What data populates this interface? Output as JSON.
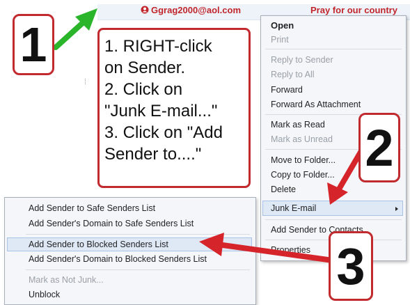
{
  "message": {
    "sender": "Ggrag2000@aol.com",
    "subject": "Pray for our country"
  },
  "instructions": {
    "lines": [
      "1. RIGHT-click",
      "on Sender.",
      "2. Click on",
      "\"Junk E-mail...\"",
      "3. Click on \"Add",
      "Sender to....\""
    ]
  },
  "context_menu": {
    "open": "Open",
    "print": "Print",
    "reply_to_sender": "Reply to Sender",
    "reply_to_all": "Reply to All",
    "forward": "Forward",
    "forward_as_attachment": "Forward As Attachment",
    "mark_as_read": "Mark as Read",
    "mark_as_unread": "Mark as Unread",
    "move_to_folder": "Move to Folder...",
    "copy_to_folder": "Copy to Folder...",
    "delete": "Delete",
    "junk_email": "Junk E-mail",
    "add_sender_to_contacts": "Add Sender to Contacts",
    "properties": "Properties"
  },
  "junk_submenu": {
    "safe_senders": "Add Sender to Safe Senders List",
    "safe_domain": "Add Sender's Domain to Safe Senders List",
    "blocked_senders": "Add Sender to Blocked Senders List",
    "blocked_domain": "Add Sender's Domain to Blocked Senders List",
    "mark_not_junk": "Mark as Not Junk...",
    "unblock": "Unblock"
  },
  "badges": {
    "step1": "1",
    "step2": "2",
    "step3": "3"
  },
  "icons": {
    "sender_icon": "contact-card-icon",
    "submenu_arrow": "chevron-right-icon"
  },
  "colors": {
    "accent_red": "#c12a2f",
    "arrow_green": "#2bb52b",
    "highlight": "#dfe9f6"
  }
}
